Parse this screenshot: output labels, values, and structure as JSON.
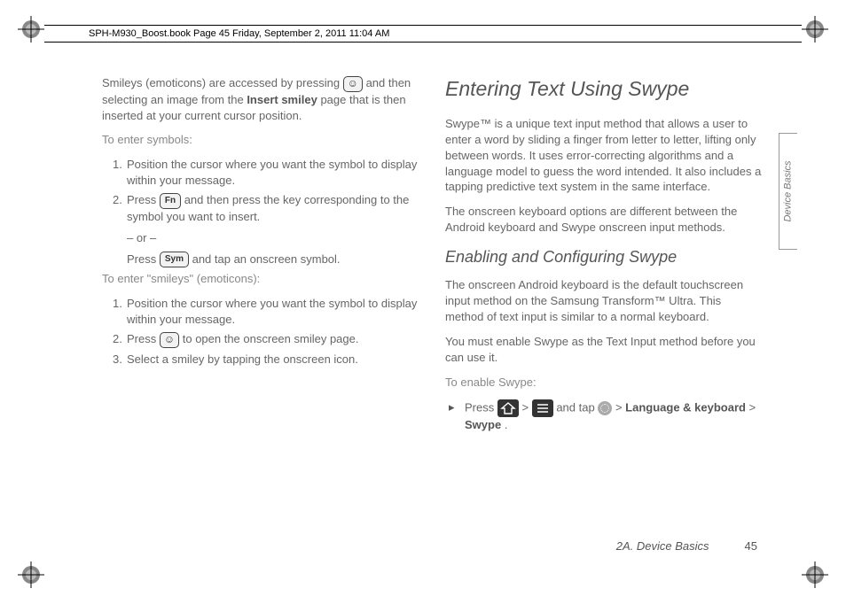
{
  "header": "SPH-M930_Boost.book  Page 45  Friday, September 2, 2011  11:04 AM",
  "side_tab": "Device Basics",
  "footer_section": "2A. Device Basics",
  "footer_page": "45",
  "left": {
    "p1a": "Smileys (emoticons) are accessed by pressing ",
    "p1b": " and then selecting an image from the ",
    "p1c_bold": "Insert smiley",
    "p1d": " page that is then inserted at your current cursor position.",
    "sub1": "To enter symbols:",
    "li1": "Position the cursor where you want the symbol to display within your message.",
    "li2a": "Press ",
    "li2b": " and then press the key corresponding to the symbol you want to insert.",
    "li2_or": "– or –",
    "li2c": "Press ",
    "li2d": " and tap an onscreen symbol.",
    "sub2": "To enter \"smileys\" (emoticons):",
    "li3": "Position the cursor where you want the symbol to display within your message.",
    "li4a": "Press ",
    "li4b": " to open the onscreen smiley page.",
    "li5": "Select a smiley by tapping the onscreen icon.",
    "fn_label": "Fn",
    "sym_label": "Sym"
  },
  "right": {
    "h1": "Entering Text Using Swype",
    "p1": "Swype™ is a unique text input method that allows a user to enter a word by sliding a finger from letter to letter, lifting only between words. It uses error-correcting algorithms and a language model to guess the word intended. It also includes a tapping predictive text system in the same interface.",
    "p2": "The onscreen keyboard options are different between the Android keyboard and Swype onscreen input methods.",
    "h2": "Enabling and Configuring Swype",
    "p3": "The onscreen Android keyboard is the default touchscreen input method on the Samsung Transform™ Ultra. This method of text input is similar to a normal keyboard.",
    "p4": "You must enable Swype as the Text Input method before you can use it.",
    "sub": "To enable Swype:",
    "step_a": "Press ",
    "step_b": " > ",
    "step_c": " and tap ",
    "step_d": " > ",
    "step_e_bold": "Language & keyboard",
    "step_f": " > ",
    "step_g_bold": "Swype",
    "step_h": "."
  }
}
